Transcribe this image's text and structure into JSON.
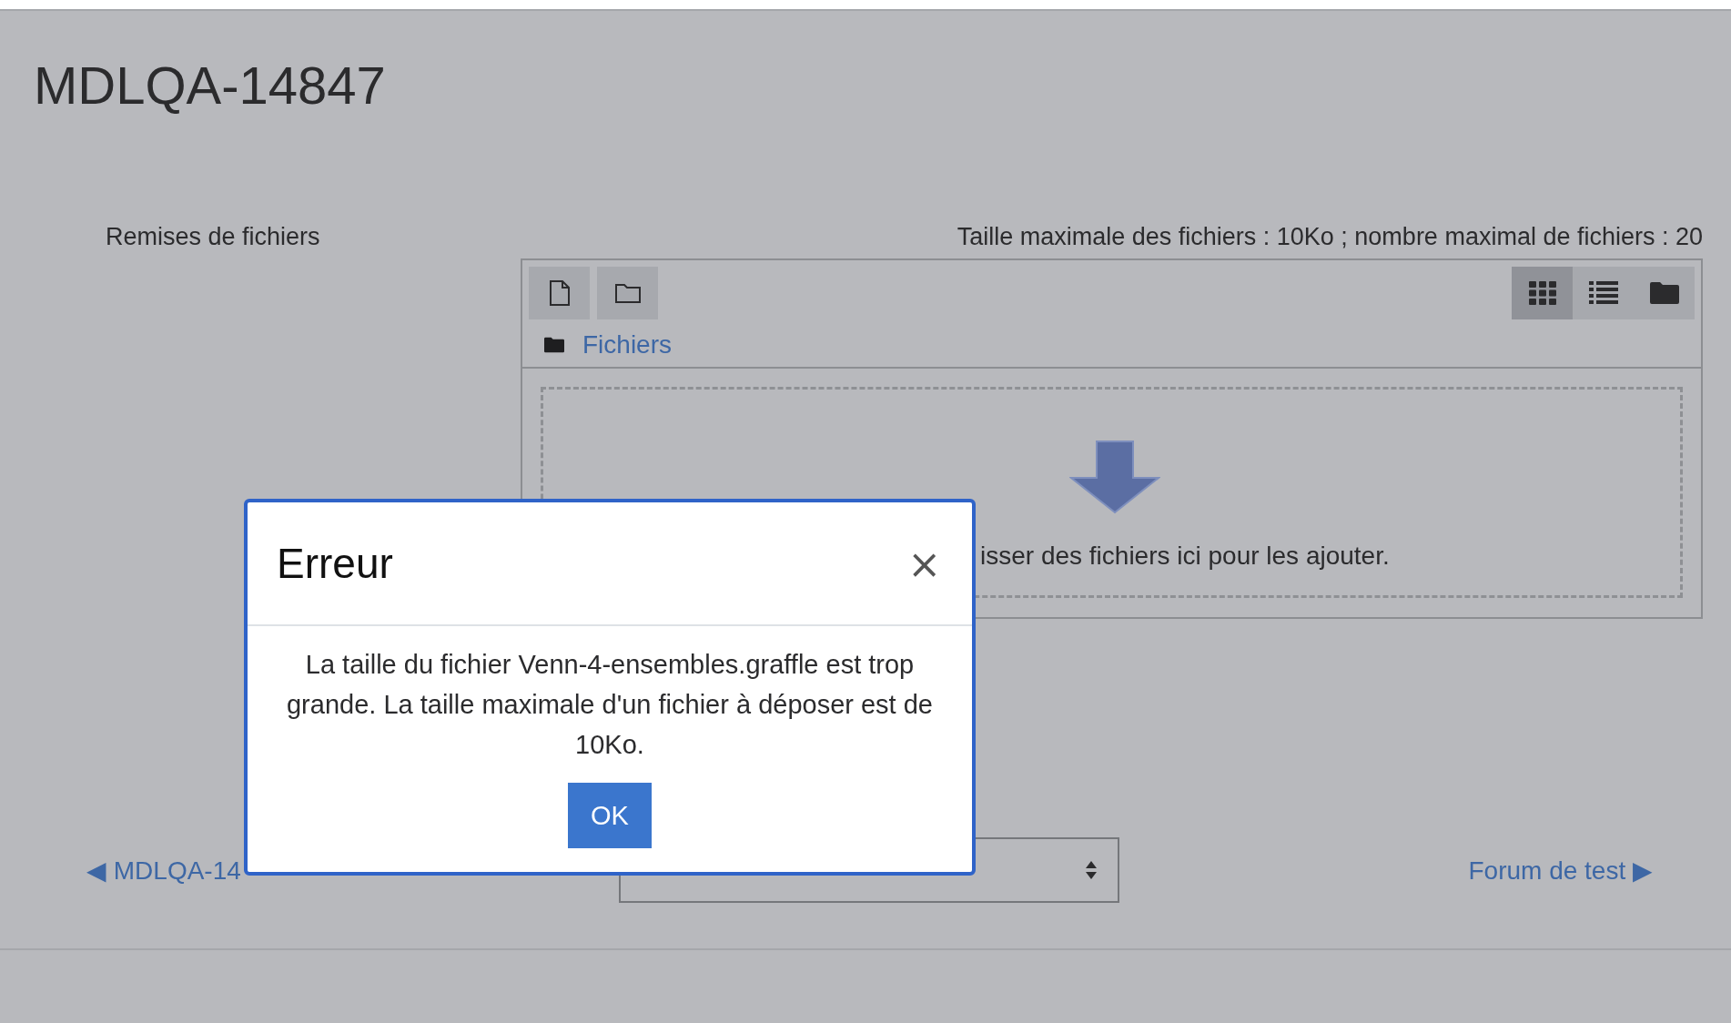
{
  "page_title": "MDLQA-14847",
  "field_label": "Remises de fichiers",
  "limits": "Taille maximale des fichiers : 10Ko ; nombre maximal de fichiers : 20",
  "toolbar": [
    {
      "kind": "file"
    },
    {
      "kind": "folder"
    }
  ],
  "views": [
    {
      "kind": "grid",
      "selected": true
    },
    {
      "kind": "list",
      "selected": false
    },
    {
      "kind": "tree",
      "selected": false
    }
  ],
  "breadcrumb": "Fichiers",
  "dropzone_text": "isser des fichiers ici pour les ajouter.",
  "nav": {
    "prev_arrow": "◀",
    "prev": "MDLQA-14",
    "next": "Forum de test",
    "next_arrow": "▶"
  },
  "modal": {
    "title": "Erreur",
    "close": "×",
    "message": "La taille du fichier Venn-4-ensembles.graffle est trop grande. La taille maximale d'un fichier à déposer est de 10Ko.",
    "button": "OK"
  }
}
